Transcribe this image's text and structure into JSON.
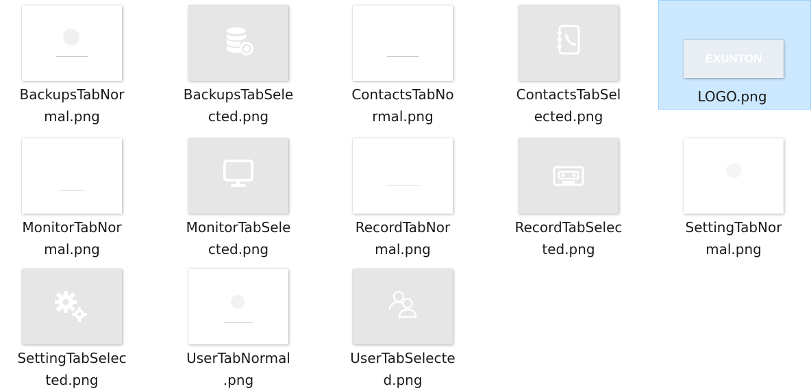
{
  "files": [
    {
      "name": "BackupsTabNor\nmal.png"
    },
    {
      "name": "BackupsTabSele\ncted.png"
    },
    {
      "name": "ContactsTabNo\nrmal.png"
    },
    {
      "name": "ContactsTabSel\nected.png"
    },
    {
      "name": "LOGO.png",
      "logo_text": "EXUNTON"
    },
    {
      "name": "MonitorTabNor\nmal.png"
    },
    {
      "name": "MonitorTabSele\ncted.png"
    },
    {
      "name": "RecordTabNor\nmal.png"
    },
    {
      "name": "RecordTabSelec\nted.png"
    },
    {
      "name": "SettingTabNor\nmal.png"
    },
    {
      "name": "SettingTabSelec\nted.png"
    },
    {
      "name": "UserTabNormal\n.png"
    },
    {
      "name": "UserTabSelecte\nd.png"
    }
  ],
  "selection_color": "#cce8ff",
  "icons": [
    "database-restore-icon",
    "contact-book-icon",
    "monitor-icon",
    "cassette-icon",
    "gears-icon",
    "users-icon"
  ]
}
